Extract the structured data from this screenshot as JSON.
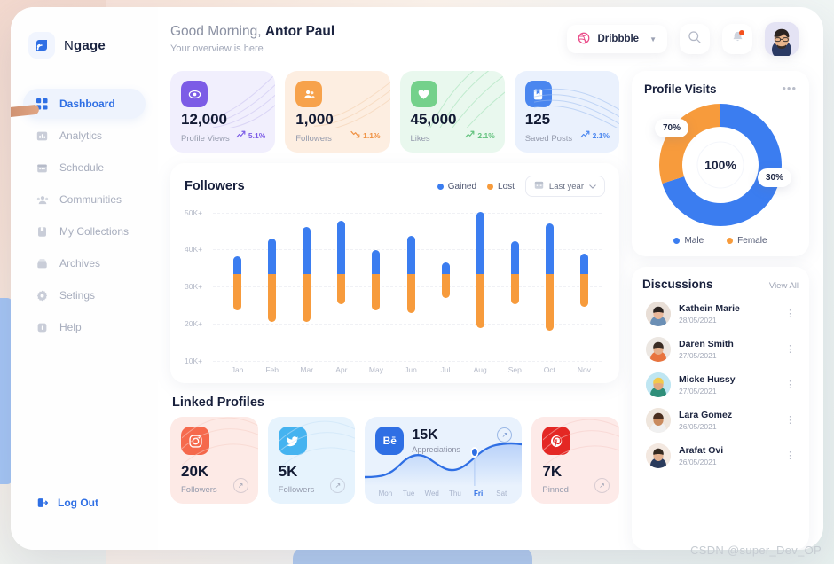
{
  "brand": {
    "name_light": "N",
    "name_bold": "gage",
    "logo_icon": "signal-logo-icon"
  },
  "sidebar": {
    "items": [
      {
        "label": "Dashboard",
        "icon": "grid-icon",
        "active": true
      },
      {
        "label": "Analytics",
        "icon": "bar-chart-icon",
        "active": false
      },
      {
        "label": "Schedule",
        "icon": "calendar-icon",
        "active": false
      },
      {
        "label": "Communities",
        "icon": "people-icon",
        "active": false
      },
      {
        "label": "My Collections",
        "icon": "bookmark-icon",
        "active": false
      },
      {
        "label": "Archives",
        "icon": "archive-icon",
        "active": false
      },
      {
        "label": "Setings",
        "icon": "gear-icon",
        "active": false
      },
      {
        "label": "Help",
        "icon": "info-icon",
        "active": false
      }
    ],
    "logout_label": "Log Out",
    "logout_icon": "logout-icon"
  },
  "header": {
    "greeting_prefix": "Good Morning, ",
    "user_name": "Antor Paul",
    "subtitle": "Your overview is here",
    "source_chip": {
      "label": "Dribbble",
      "icon": "dribbble-icon",
      "caret": "▼"
    },
    "search_icon": "search-icon",
    "bell_icon": "bell-icon",
    "avatar_name": "user-avatar"
  },
  "stats": [
    {
      "value": "12,000",
      "label": "Profile Views",
      "delta": "5.1%",
      "trend": "up",
      "icon": "eye-icon",
      "bg": "#f0eefc",
      "icon_bg": "#7c5ce6",
      "accent": "#7c5ce6"
    },
    {
      "value": "1,000",
      "label": "Followers",
      "delta": "1.1%",
      "trend": "down",
      "icon": "users-icon",
      "bg": "#fdeee0",
      "icon_bg": "#f7a24b",
      "accent": "#f2974a"
    },
    {
      "value": "45,000",
      "label": "Likes",
      "delta": "2.1%",
      "trend": "up",
      "icon": "heart-icon",
      "bg": "#e9f8ee",
      "icon_bg": "#74d18b",
      "accent": "#6ec886"
    },
    {
      "value": "125",
      "label": "Saved Posts",
      "delta": "2.1%",
      "trend": "up",
      "icon": "bookmark-icon",
      "bg": "#eaf1fd",
      "icon_bg": "#4a86ef",
      "accent": "#4a86ef"
    }
  ],
  "followers_panel": {
    "title": "Followers",
    "legend": [
      {
        "label": "Gained",
        "color": "#3b7df0"
      },
      {
        "label": "Lost",
        "color": "#f79b3c"
      }
    ],
    "range_label": "Last year",
    "range_icon": "calendar-icon"
  },
  "chart_data": {
    "type": "bar",
    "title": "Followers",
    "xlabel": "",
    "ylabel": "",
    "ylim": [
      5,
      55
    ],
    "yticks": [
      50,
      40,
      30,
      20,
      10
    ],
    "ytick_labels": [
      "50K+",
      "40K+",
      "30K+",
      "20K+",
      "10K+"
    ],
    "grid": true,
    "legend_position": "top-right",
    "categories": [
      "Jan",
      "Feb",
      "Mar",
      "Apr",
      "May",
      "Jun",
      "Jul",
      "Aug",
      "Sep",
      "Oct",
      "Nov"
    ],
    "series": [
      {
        "name": "Gained",
        "color": "#3b7df0",
        "values": [
          38,
          44,
          48,
          50,
          40,
          45,
          36,
          53,
          43,
          49,
          39
        ]
      },
      {
        "name": "Lost",
        "color": "#f79b3c",
        "values": [
          20,
          16,
          16,
          22,
          20,
          19,
          24,
          14,
          22,
          13,
          21
        ]
      }
    ],
    "split_at": 32,
    "note": "Each bar is a rounded split bar: blue (Gained) from split point up to series value, orange (Lost) from split point down to series value."
  },
  "linked_profiles": {
    "title": "Linked Profiles",
    "cards": [
      {
        "platform": "instagram",
        "icon": "instagram-icon",
        "value": "20K",
        "label": "Followers",
        "bg": "#fdeae6",
        "icon_bg": "#f4674a",
        "arrow_icon": "arrow-up-right-icon"
      },
      {
        "platform": "twitter",
        "icon": "twitter-icon",
        "value": "5K",
        "label": "Followers",
        "bg": "#e6f3fd",
        "icon_bg": "#45b3f0",
        "arrow_icon": "arrow-up-right-icon"
      },
      {
        "platform": "pinterest",
        "icon": "pinterest-icon",
        "value": "7K",
        "label": "Pinned",
        "bg": "#fdeae8",
        "icon_bg": "#e42724",
        "arrow_icon": "arrow-up-right-icon"
      }
    ],
    "behance": {
      "icon": "behance-icon",
      "icon_text": "Bē",
      "value": "15K",
      "label": "Appreciations",
      "bg": "#e9f2fd",
      "icon_bg": "#2f6fe4",
      "arrow_icon": "arrow-up-right-icon",
      "days": [
        "Mon",
        "Tue",
        "Wed",
        "Thu",
        "Fri",
        "Sat"
      ],
      "active_day": "Fri",
      "chart_data": {
        "type": "area",
        "x": [
          "Mon",
          "Tue",
          "Wed",
          "Thu",
          "Fri",
          "Sat"
        ],
        "values": [
          18,
          42,
          55,
          38,
          62,
          70
        ],
        "marker_at": "Fri",
        "color": "#2f6fe4"
      }
    }
  },
  "profile_visits": {
    "title": "Profile Visits",
    "menu_icon": "ellipsis-icon",
    "center_label": "100%",
    "callout_left": "70%",
    "callout_right": "30%",
    "chart_data": {
      "type": "pie",
      "title": "Profile Visits",
      "labels": [
        "Male",
        "Female"
      ],
      "values": [
        70,
        30
      ],
      "colors": [
        "#3b7df0",
        "#f79b3c"
      ],
      "center_text": "100%",
      "legend_position": "bottom"
    },
    "legend": [
      {
        "label": "Male",
        "color": "#3b7df0"
      },
      {
        "label": "Female",
        "color": "#f79b3c"
      }
    ]
  },
  "discussions": {
    "title": "Discussions",
    "view_all_label": "View All",
    "items": [
      {
        "name": "Kathein Marie",
        "date": "28/05/2021",
        "avatar_bg": "#e8ded6",
        "skin": "#e8b79a",
        "hair": "#2b2320",
        "shirt": "#6b8fb5"
      },
      {
        "name": "Daren Smith",
        "date": "27/05/2021",
        "avatar_bg": "#ece7e2",
        "skin": "#e5b08d",
        "hair": "#3a2c24",
        "shirt": "#e8743f"
      },
      {
        "name": "Micke Hussy",
        "date": "27/05/2021",
        "avatar_bg": "#bfe6f2",
        "skin": "#e2a97f",
        "hair": "#f2c94c",
        "shirt": "#2f8f7a"
      },
      {
        "name": "Lara Gomez",
        "date": "26/05/2021",
        "avatar_bg": "#efe6dd",
        "skin": "#c98b5f",
        "hair": "#4a2e1f",
        "shirt": "#f0f0f0"
      },
      {
        "name": "Arafat Ovi",
        "date": "26/05/2021",
        "avatar_bg": "#f3e8e0",
        "skin": "#e3b190",
        "hair": "#33281f",
        "shirt": "#2a3b5c"
      }
    ],
    "kebab_icon": "kebab-menu-icon"
  },
  "watermark": "CSDN @super_Dev_OP"
}
